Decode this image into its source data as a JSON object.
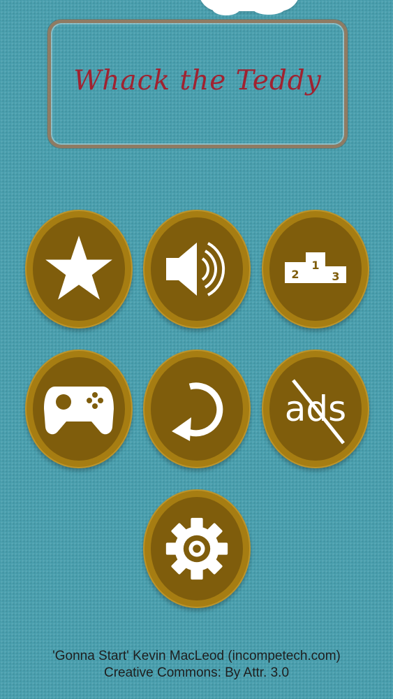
{
  "app": {
    "title": "Whack the Teddy"
  },
  "colors": {
    "background": "#4a9fae",
    "button_ring": "#a67d12",
    "button_fill": "#7f5d0c",
    "icon": "#ffffff",
    "title_text": "#a02230",
    "panel_border": "#8f7b63"
  },
  "menu": {
    "buttons": [
      {
        "id": "rate",
        "icon": "star-icon"
      },
      {
        "id": "sound",
        "icon": "speaker-icon"
      },
      {
        "id": "leaderboard",
        "icon": "podium-icon",
        "podium_labels": [
          "1",
          "2",
          "3"
        ]
      },
      {
        "id": "games",
        "icon": "gamepad-icon"
      },
      {
        "id": "restart",
        "icon": "refresh-icon"
      },
      {
        "id": "no-ads",
        "icon": "no-ads-icon",
        "label": "ads"
      },
      {
        "id": "settings",
        "icon": "gear-icon"
      }
    ]
  },
  "credits": {
    "line1": "'Gonna Start' Kevin MacLeod (incompetech.com)",
    "line2": "Creative Commons: By Attr. 3.0"
  }
}
